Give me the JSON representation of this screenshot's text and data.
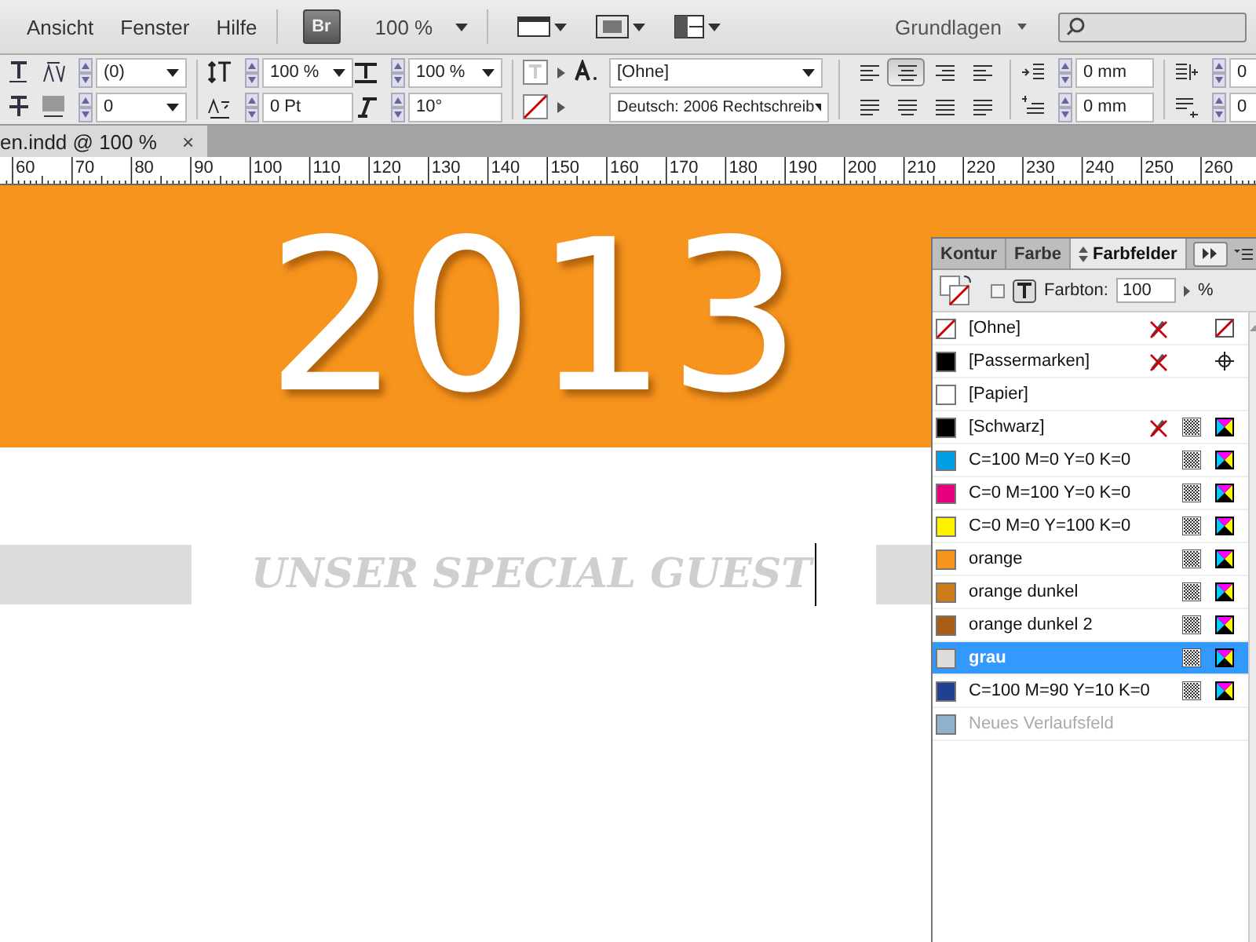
{
  "menu": {
    "items": [
      "Ansicht",
      "Fenster",
      "Hilfe"
    ],
    "bridge": "Br",
    "zoom": "100 %",
    "workspace": "Grundlagen"
  },
  "control_bar": {
    "tracking": "(0)",
    "kerning": "0",
    "vertical_scale": "100 %",
    "baseline_shift": "0 Pt",
    "horizontal_scale": "100 %",
    "skew": "10°",
    "char_style": "[Ohne]",
    "language": "Deutsch: 2006 Rechtschreib",
    "align_buttons": [
      {
        "kind": "left",
        "selected": false
      },
      {
        "kind": "center",
        "selected": true
      },
      {
        "kind": "right",
        "selected": false
      },
      {
        "kind": "towards-spine",
        "selected": false
      },
      {
        "kind": "justify-left",
        "selected": false
      },
      {
        "kind": "justify-center",
        "selected": false
      },
      {
        "kind": "justify-all",
        "selected": false
      },
      {
        "kind": "away-spine",
        "selected": false
      }
    ],
    "left_indent": "0 mm",
    "first_line_indent": "0 mm",
    "right_indent": "0",
    "last_line_indent": "0"
  },
  "document_tab": {
    "title": "en.indd @ 100 %",
    "close": "×"
  },
  "ruler": [
    "60",
    "70",
    "80",
    "90",
    "100",
    "110",
    "120",
    "130",
    "140",
    "150",
    "160",
    "170",
    "180",
    "190",
    "200",
    "210",
    "220",
    "230",
    "240",
    "250",
    "260"
  ],
  "canvas": {
    "headline": "2013",
    "subheading": "UNSER SPECIAL GUEST"
  },
  "swatches_panel": {
    "tabs": [
      {
        "label": "Kontur",
        "selected": false
      },
      {
        "label": "Farbe",
        "selected": false
      },
      {
        "label": "Farbfelder",
        "selected": true
      }
    ],
    "text_checkbox": {
      "checked": false
    },
    "tint_label": "Farbton:",
    "tint": "100",
    "percent": "%",
    "swatches": [
      {
        "name": "[Ohne]",
        "kind": "none",
        "color": "#ffffff",
        "selected": false
      },
      {
        "name": "[Passermarken]",
        "kind": "registration",
        "color": "#000000",
        "selected": false
      },
      {
        "name": "[Papier]",
        "kind": "paper",
        "color": "#ffffff",
        "selected": false
      },
      {
        "name": "[Schwarz]",
        "kind": "black",
        "color": "#000000",
        "selected": false
      },
      {
        "name": "C=100 M=0 Y=0 K=0",
        "kind": "process",
        "color": "#00a0e6",
        "selected": false
      },
      {
        "name": "C=0 M=100 Y=0 K=0",
        "kind": "process",
        "color": "#e6007e",
        "selected": false
      },
      {
        "name": "C=0 M=0 Y=100 K=0",
        "kind": "process",
        "color": "#fff200",
        "selected": false
      },
      {
        "name": "orange",
        "kind": "process",
        "color": "#f7941d",
        "selected": false
      },
      {
        "name": "orange dunkel",
        "kind": "process",
        "color": "#cc7a1a",
        "selected": false
      },
      {
        "name": "orange dunkel 2",
        "kind": "process",
        "color": "#a65f14",
        "selected": false
      },
      {
        "name": "grau",
        "kind": "process",
        "color": "#dcdcdc",
        "selected": true
      },
      {
        "name": "C=100 M=90 Y=10 K=0",
        "kind": "process",
        "color": "#233f8f",
        "selected": false
      },
      {
        "name": "Neues Verlaufsfeld",
        "kind": "new",
        "color": "#8fb3cc",
        "selected": false
      }
    ]
  }
}
